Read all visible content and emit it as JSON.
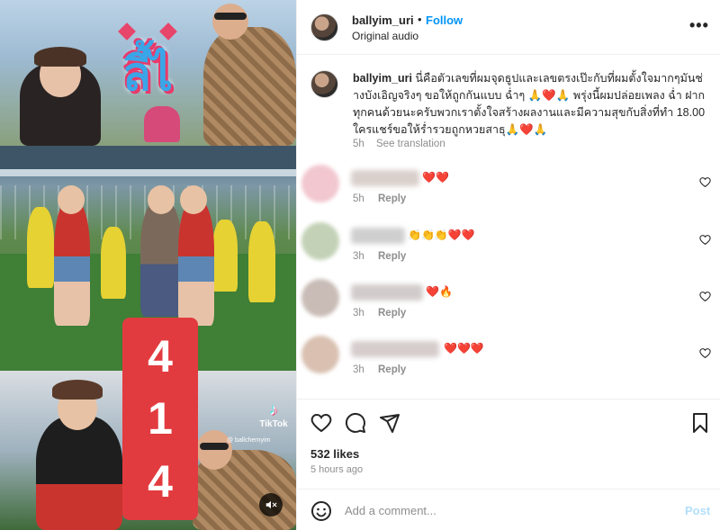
{
  "media": {
    "logo_text": "ลี้ไ",
    "counter_digits": [
      "4",
      "1",
      "4"
    ],
    "tiktok_note": "♪",
    "tiktok_brand": "TikTok",
    "tiktok_handle": "@ ballchernyim",
    "mute_icon": "speaker-muted-icon"
  },
  "header": {
    "username": "ballyim_uri",
    "separator": "•",
    "follow_label": "Follow",
    "subtitle": "Original audio",
    "more_icon": "•••"
  },
  "caption": {
    "username": "ballyim_uri",
    "text": "นี่คือตัวเลขที่ผมจุดธูปและเลขตรงเป๊ะกับที่ผมตั้งใจมากๆมันช่างบังเอิญจริงๆ ขอให้ถูกกันแบบ ฉ่ำๆ 🙏❤️🙏 พรุ่งนี้ผมปล่อยเพลง ฉ่ำ ฝากทุกคนด้วยนะครับพวกเราตั้งใจสร้างผลงานและมีความสุขกับสิ่งที่ทำ 18.00 ใครแชร์ขอให้ร่ำรวยถูกหวยสาธุ🙏❤️🙏",
    "time": "5h",
    "see_translation": "See translation"
  },
  "comments": [
    {
      "emoji": "❤️❤️",
      "time": "5h",
      "reply_label": "Reply",
      "avatar_color": "#f2c7cf",
      "name_color": "#d9d0cc"
    },
    {
      "emoji": "👏👏👏❤️❤️",
      "time": "3h",
      "reply_label": "Reply",
      "avatar_color": "#c3d2b6",
      "name_color": "#cfcfcf"
    },
    {
      "emoji": "❤️🔥",
      "time": "3h",
      "reply_label": "Reply",
      "avatar_color": "#c9bcb6",
      "name_color": "#d2cbcb"
    },
    {
      "emoji": "❤️❤️❤️",
      "time": "3h",
      "reply_label": "Reply",
      "avatar_color": "#d9c0b0",
      "name_color": "#d6cccc"
    }
  ],
  "actions": {
    "likes": "532 likes",
    "posted": "5 hours ago"
  },
  "composer": {
    "placeholder": "Add a comment...",
    "post_label": "Post"
  }
}
